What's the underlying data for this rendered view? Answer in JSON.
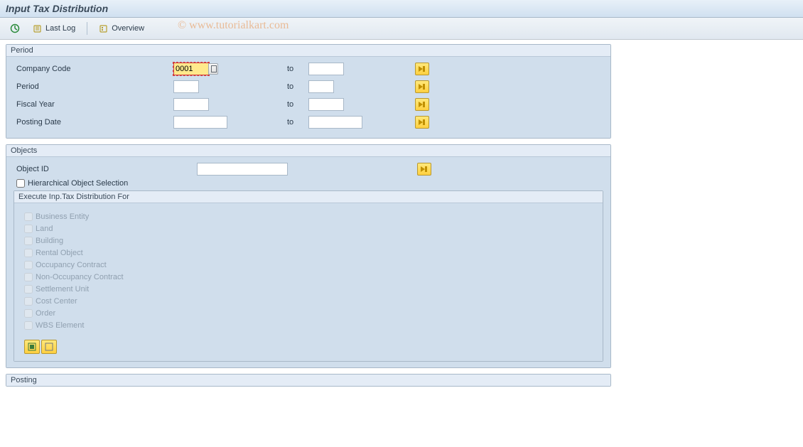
{
  "header": {
    "title": "Input Tax Distribution"
  },
  "toolbar": {
    "last_log": "Last Log",
    "overview": "Overview"
  },
  "watermark": "© www.tutorialkart.com",
  "period_panel": {
    "title": "Period",
    "rows": {
      "company_code": {
        "label": "Company Code",
        "from": "0001",
        "to_label": "to",
        "to": ""
      },
      "period": {
        "label": "Period",
        "from": "",
        "to_label": "to",
        "to": ""
      },
      "fiscal_year": {
        "label": "Fiscal Year",
        "from": "",
        "to_label": "to",
        "to": ""
      },
      "posting_date": {
        "label": "Posting Date",
        "from": "",
        "to_label": "to",
        "to": ""
      }
    }
  },
  "objects_panel": {
    "title": "Objects",
    "object_id_label": "Object ID",
    "object_id_value": "",
    "hierarchical_label": "Hierarchical Object Selection",
    "exec_title": "Execute Inp.Tax Distribution For",
    "checks": {
      "business_entity": "Business Entity",
      "land": "Land",
      "building": "Building",
      "rental_object": "Rental Object",
      "occupancy_contract": "Occupancy Contract",
      "non_occupancy_contract": "Non-Occupancy Contract",
      "settlement_unit": "Settlement Unit",
      "cost_center": "Cost Center",
      "order": "Order",
      "wbs_element": "WBS Element"
    }
  },
  "posting_panel": {
    "title": "Posting"
  }
}
